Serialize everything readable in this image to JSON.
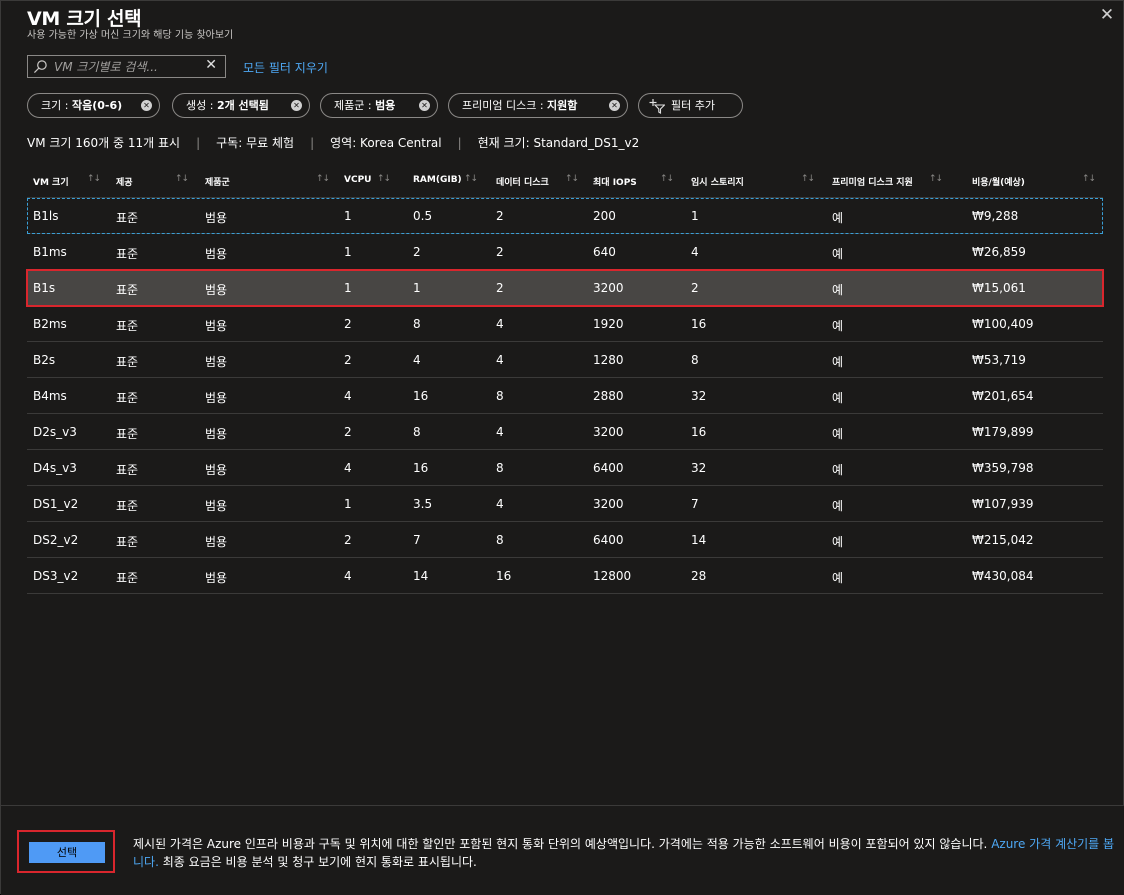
{
  "header": {
    "title": "VM 크기 선택",
    "subtitle": "사용 가능한 가상 머신 크기와 해당 기능 찾아보기",
    "close_glyph": "✕"
  },
  "search": {
    "placeholder": "VM 크기별로 검색...",
    "clear_glyph": "✕"
  },
  "clear_filters_label": "모든 필터 지우기",
  "filters": [
    {
      "prefix": "크기 : ",
      "value": "작음(0-6)"
    },
    {
      "prefix": "생성 : ",
      "value": "2개 선택됨"
    },
    {
      "prefix": "제품군 : ",
      "value": "범용"
    },
    {
      "prefix": "프리미엄 디스크 : ",
      "value": "지원함"
    }
  ],
  "add_filter_label": "필터 추가",
  "summary": {
    "count": "VM 크기 160개 중 11개 표시",
    "subscription": "구독: 무료 체험",
    "region": "영역: Korea Central",
    "current_size": "현재 크기: Standard_DS1_v2",
    "separator": "|"
  },
  "table": {
    "sort_glyph": "↑↓",
    "columns": [
      "VM 크기",
      "제공",
      "제품군",
      "VCPU",
      "RAM(GIB)",
      "데이터 디스크",
      "최대 IOPS",
      "임시 스토리지",
      "프리미엄 디스크 지원",
      "비용/월(예상)"
    ],
    "rows": [
      [
        "B1ls",
        "표준",
        "범용",
        "1",
        "0.5",
        "2",
        "200",
        "1",
        "예",
        "₩9,288"
      ],
      [
        "B1ms",
        "표준",
        "범용",
        "1",
        "2",
        "2",
        "640",
        "4",
        "예",
        "₩26,859"
      ],
      [
        "B1s",
        "표준",
        "범용",
        "1",
        "1",
        "2",
        "3200",
        "2",
        "예",
        "₩15,061"
      ],
      [
        "B2ms",
        "표준",
        "범용",
        "2",
        "8",
        "4",
        "1920",
        "16",
        "예",
        "₩100,409"
      ],
      [
        "B2s",
        "표준",
        "범용",
        "2",
        "4",
        "4",
        "1280",
        "8",
        "예",
        "₩53,719"
      ],
      [
        "B4ms",
        "표준",
        "범용",
        "4",
        "16",
        "8",
        "2880",
        "32",
        "예",
        "₩201,654"
      ],
      [
        "D2s_v3",
        "표준",
        "범용",
        "2",
        "8",
        "4",
        "3200",
        "16",
        "예",
        "₩179,899"
      ],
      [
        "D4s_v3",
        "표준",
        "범용",
        "4",
        "16",
        "8",
        "6400",
        "32",
        "예",
        "₩359,798"
      ],
      [
        "DS1_v2",
        "표준",
        "범용",
        "1",
        "3.5",
        "4",
        "3200",
        "7",
        "예",
        "₩107,939"
      ],
      [
        "DS2_v2",
        "표준",
        "범용",
        "2",
        "7",
        "8",
        "6400",
        "14",
        "예",
        "₩215,042"
      ],
      [
        "DS3_v2",
        "표준",
        "범용",
        "4",
        "14",
        "16",
        "12800",
        "28",
        "예",
        "₩430,084"
      ]
    ],
    "focused_row": 0,
    "selected_row": 2
  },
  "footer": {
    "select_label": "선택",
    "text_part1": "제시된 가격은 Azure 인프라 비용과 구독 및 위치에 대한 할인만 포함된 현지 통화 단위의 예상액입니다. 가격에는 적용 가능한 소프트웨어 비용이 포함되어 있지 않습니다.",
    "link_label": "Azure 가격 계산기를 봅니다.",
    "text_part2": " 최종 요금은 비용 분석 및 청구 보기에 현지 통화로 표시됩니다."
  },
  "colors": {
    "background": "#1b1a19",
    "accent_blue": "#4f9af5",
    "link_blue": "#4ea8f4",
    "highlight_red": "#d9262d",
    "selected_row": "#484644"
  }
}
